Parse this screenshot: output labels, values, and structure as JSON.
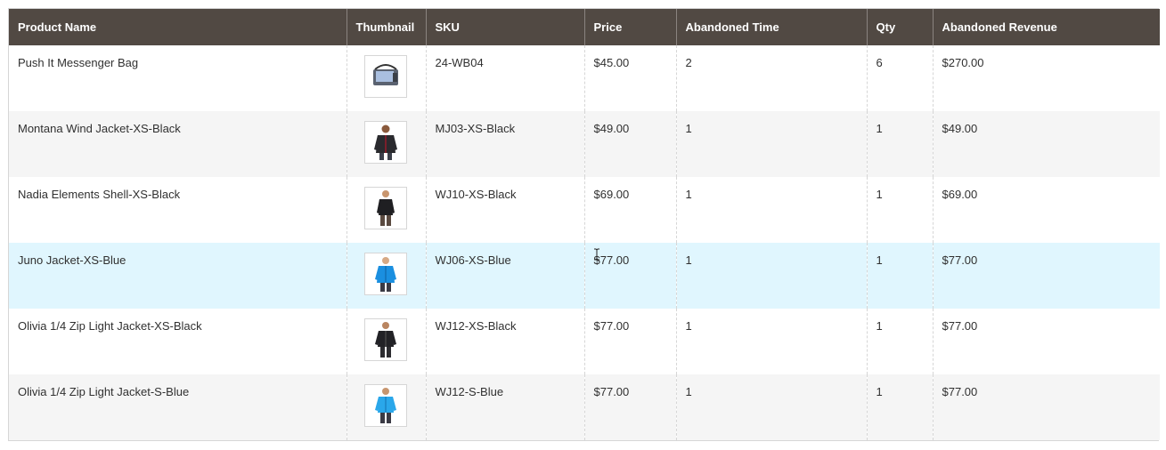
{
  "columns": {
    "product_name": "Product Name",
    "thumbnail": "Thumbnail",
    "sku": "SKU",
    "price": "Price",
    "abandoned_time": "Abandoned Time",
    "qty": "Qty",
    "abandoned_revenue": "Abandoned Revenue"
  },
  "rows": [
    {
      "product_name": "Push It Messenger Bag",
      "thumbnail_icon": "messenger-bag-icon",
      "sku": "24-WB04",
      "price": "$45.00",
      "abandoned_time": "2",
      "qty": "6",
      "abandoned_revenue": "$270.00"
    },
    {
      "product_name": "Montana Wind Jacket-XS-Black",
      "thumbnail_icon": "black-jacket-icon",
      "sku": "MJ03-XS-Black",
      "price": "$49.00",
      "abandoned_time": "1",
      "qty": "1",
      "abandoned_revenue": "$49.00"
    },
    {
      "product_name": "Nadia Elements Shell-XS-Black",
      "thumbnail_icon": "black-jacket-icon",
      "sku": "WJ10-XS-Black",
      "price": "$69.00",
      "abandoned_time": "1",
      "qty": "1",
      "abandoned_revenue": "$69.00"
    },
    {
      "product_name": "Juno Jacket-XS-Blue",
      "thumbnail_icon": "blue-jacket-icon",
      "sku": "WJ06-XS-Blue",
      "price": "$77.00",
      "abandoned_time": "1",
      "qty": "1",
      "abandoned_revenue": "$77.00"
    },
    {
      "product_name": "Olivia 1/4 Zip Light Jacket-XS-Black",
      "thumbnail_icon": "black-jacket-icon",
      "sku": "WJ12-XS-Black",
      "price": "$77.00",
      "abandoned_time": "1",
      "qty": "1",
      "abandoned_revenue": "$77.00"
    },
    {
      "product_name": "Olivia 1/4 Zip Light Jacket-S-Blue",
      "thumbnail_icon": "blue-jacket-icon",
      "sku": "WJ12-S-Blue",
      "price": "$77.00",
      "abandoned_time": "1",
      "qty": "1",
      "abandoned_revenue": "$77.00"
    }
  ],
  "colors": {
    "header_bg": "#514943",
    "header_text": "#ffffff",
    "row_alt_bg": "#f5f5f5",
    "row_hover_bg": "#e0f6fe",
    "border": "#d6d6d6"
  }
}
